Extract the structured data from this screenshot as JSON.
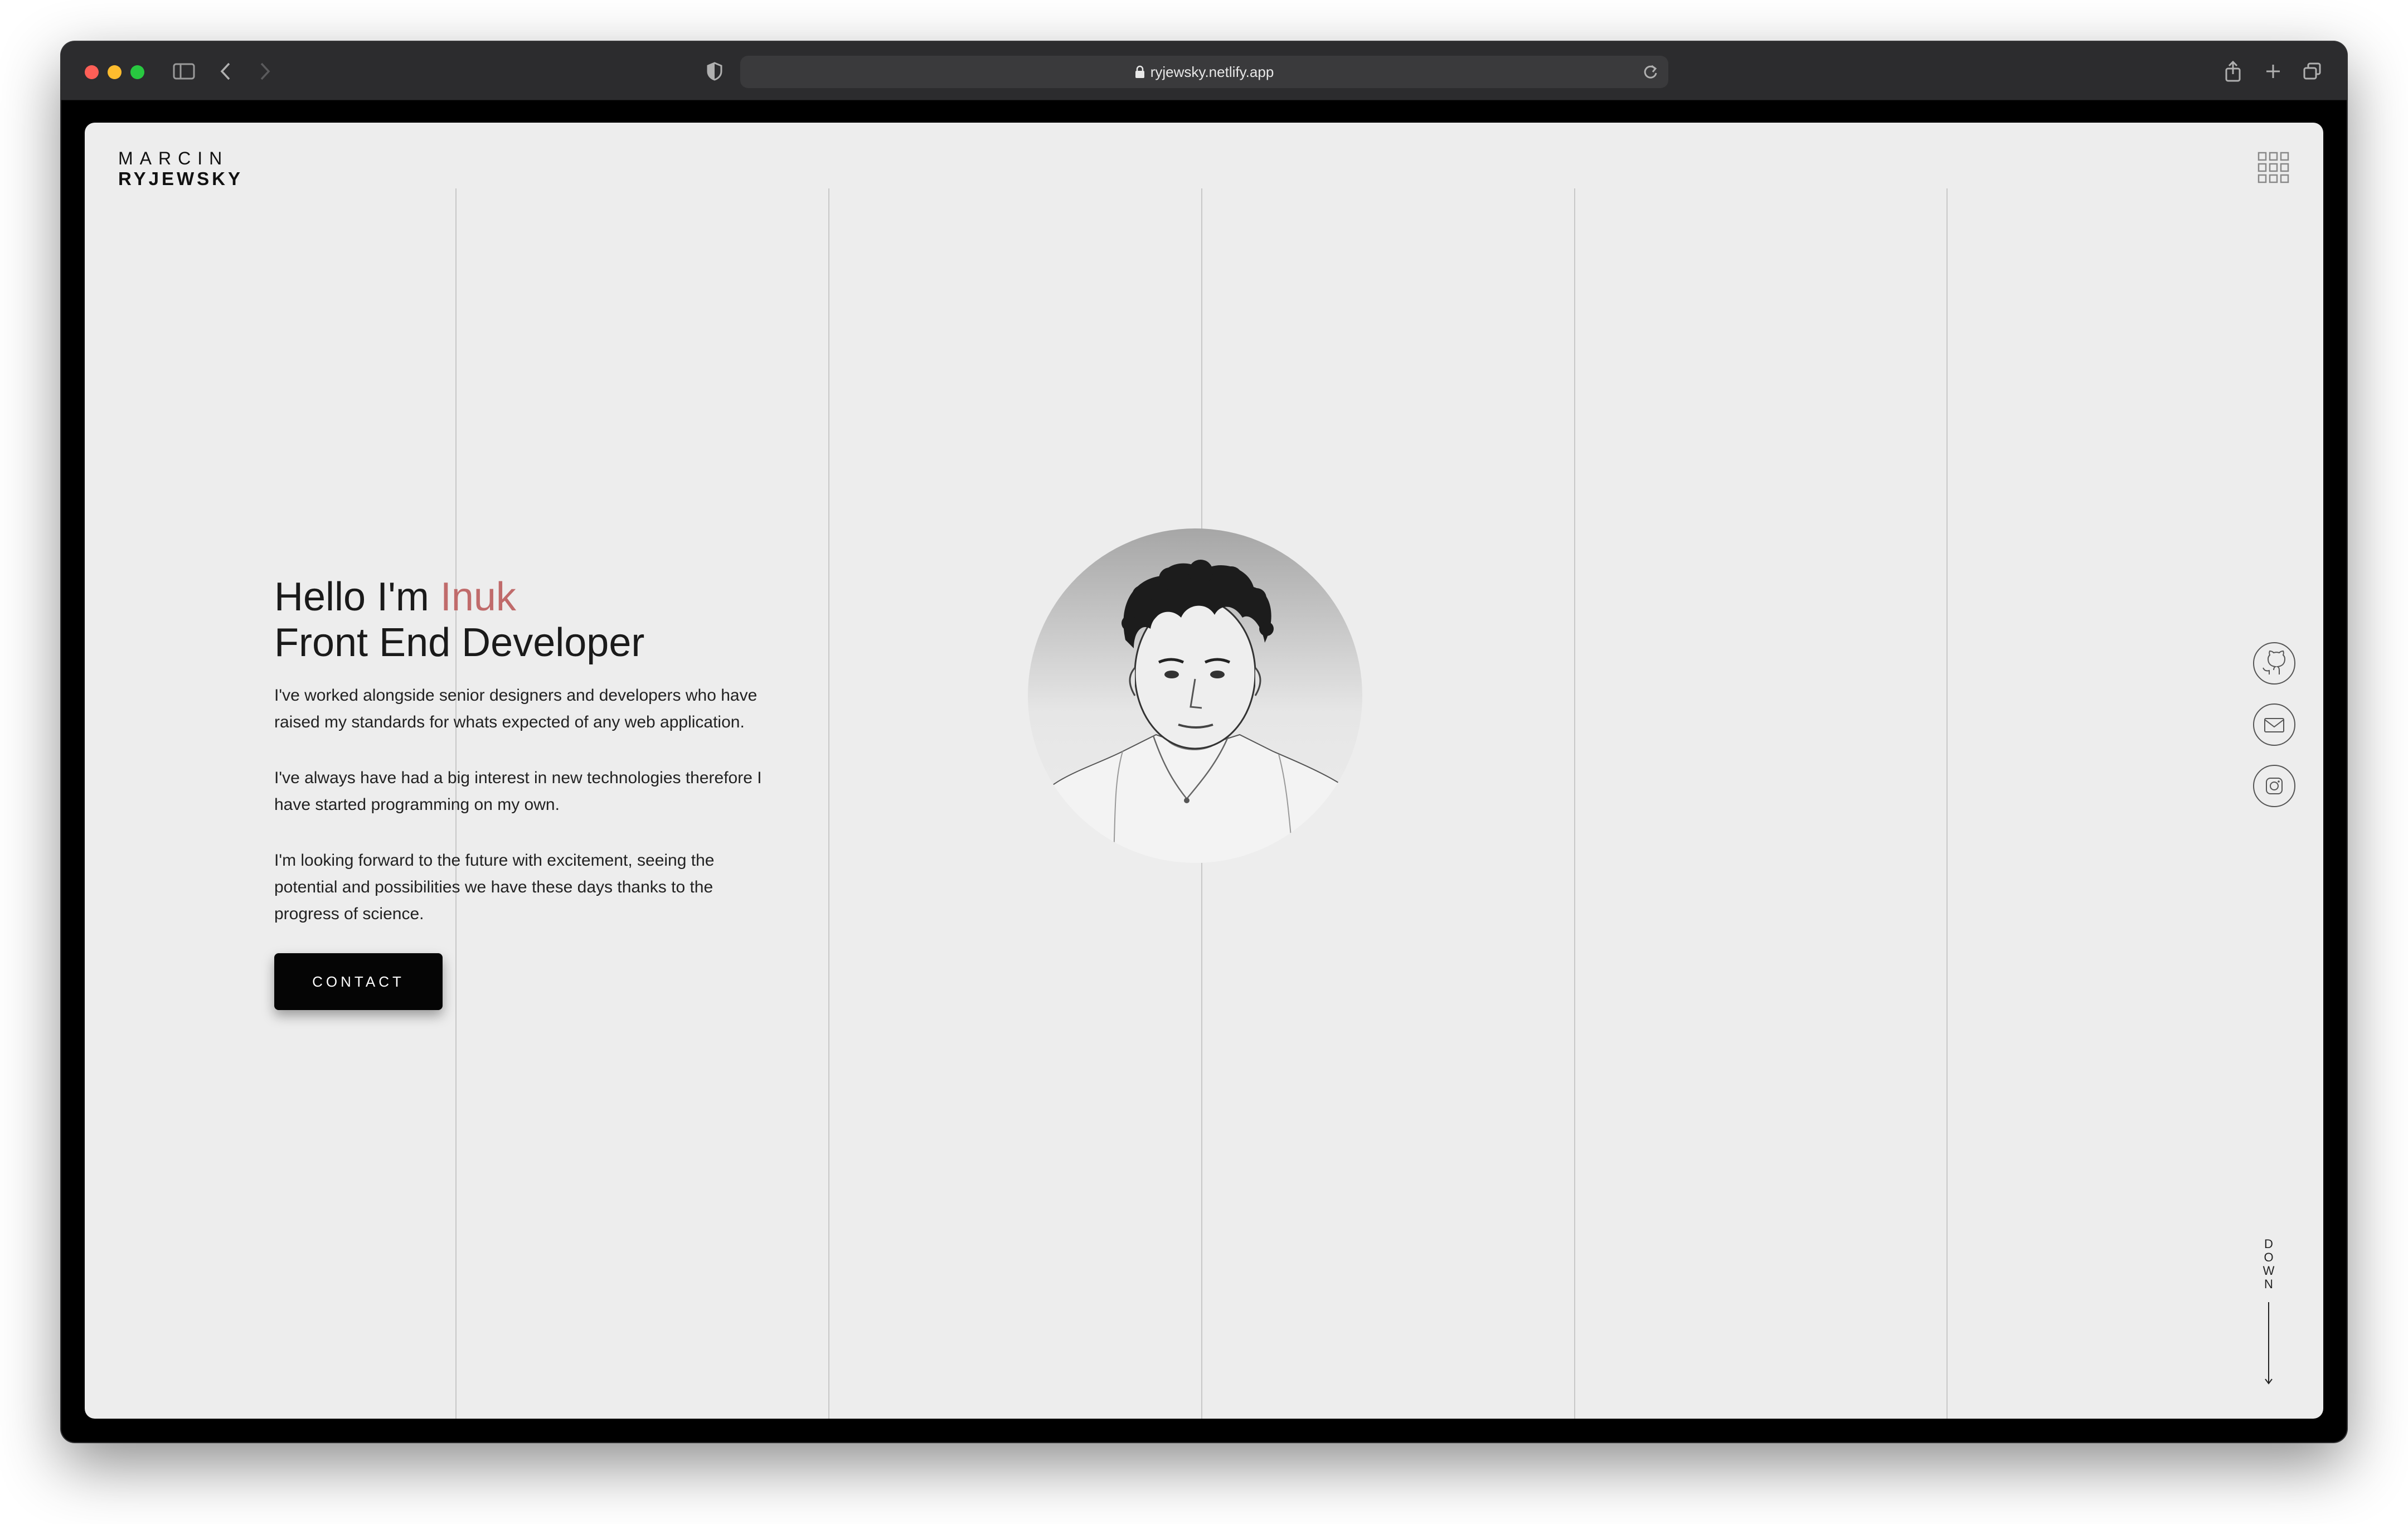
{
  "browser": {
    "url": "ryjewsky.netlify.app",
    "icons": [
      "sidebar-icon",
      "back-icon",
      "forward-icon",
      "shield-icon",
      "lock-icon",
      "reload-icon",
      "share-icon",
      "new-tab-icon",
      "tab-overview-icon"
    ]
  },
  "site": {
    "logo": {
      "first": "MARCIN",
      "last": "RYJEWSKY"
    },
    "menu_icon": "grid-menu-icon",
    "hero": {
      "greeting_prefix": "Hello I'm ",
      "name": "Inuk",
      "role": "Front End Developer",
      "paragraphs": [
        "I've worked alongside senior designers and developers who have raised my standards for whats expected of any web application.",
        "I've always have had a big interest in new technologies therefore I have started programming on my own.",
        "I'm looking forward to the future with excitement, seeing the potential and possibilities we have these days thanks to the progress of science."
      ],
      "contact_label": "CONTACT"
    },
    "social": [
      {
        "name": "github",
        "icon": "github-icon"
      },
      {
        "name": "email",
        "icon": "mail-icon"
      },
      {
        "name": "instagram",
        "icon": "instagram-icon"
      }
    ],
    "scroll_indicator": {
      "letters": [
        "D",
        "O",
        "W",
        "N"
      ]
    },
    "colors": {
      "accent": "#c06b6b",
      "background": "#ededed",
      "button": "#050505",
      "gridline": "#c8c8c8"
    }
  }
}
